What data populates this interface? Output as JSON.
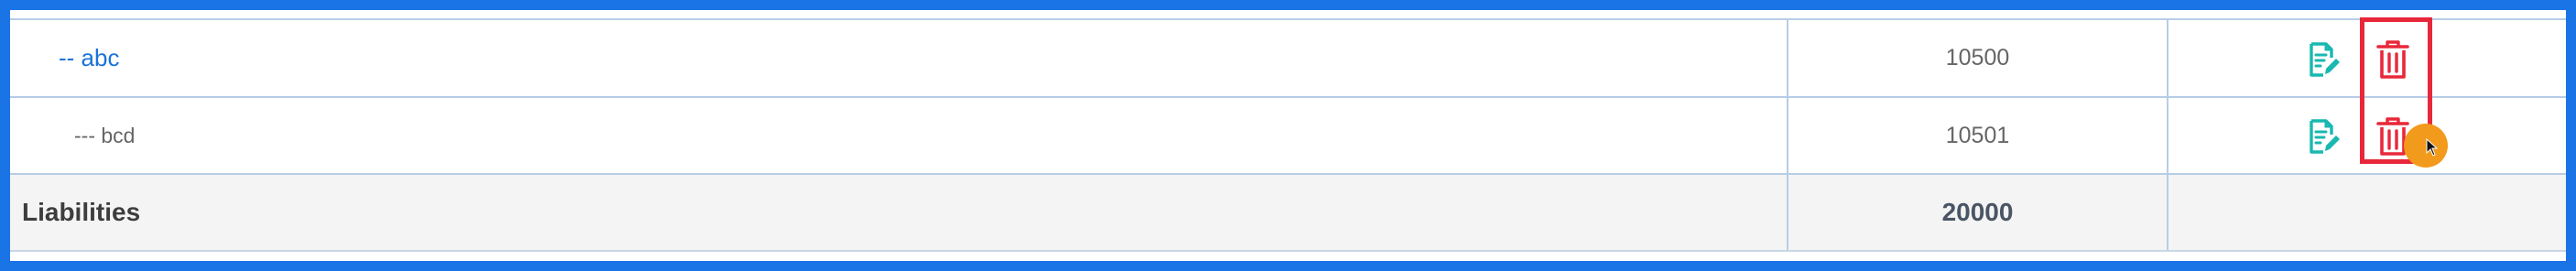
{
  "rows": [
    {
      "name": "-- abc",
      "code": "10500",
      "edit_icon": "edit-document-icon",
      "delete_icon": "trash-icon"
    },
    {
      "name": "--- bcd",
      "code": "10501",
      "edit_icon": "edit-document-icon",
      "delete_icon": "trash-icon"
    }
  ],
  "total_row": {
    "name": "Liabilities",
    "code": "20000"
  },
  "colors": {
    "frame_border": "#1b74e6",
    "link_text": "#1a73d9",
    "edit_icon": "#19b8b0",
    "delete_icon": "#e8283a",
    "highlight_box": "#e8283a",
    "cursor_dot": "#f29a1b",
    "total_row_bg": "#f4f4f4"
  }
}
